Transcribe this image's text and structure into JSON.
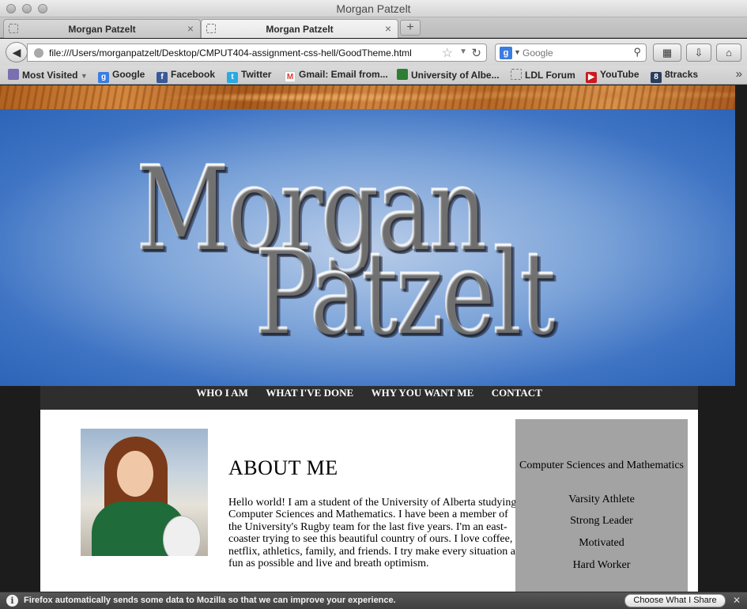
{
  "window": {
    "title": "Morgan Patzelt"
  },
  "tabs": [
    {
      "label": "Morgan Patzelt",
      "active": false
    },
    {
      "label": "Morgan Patzelt",
      "active": true
    }
  ],
  "navbar": {
    "url": "file:///Users/morganpatzelt/Desktop/CMPUT404-assignment-css-hell/GoodTheme.html",
    "search_placeholder": "Google",
    "search_engine_glyph": "g"
  },
  "bookmarks": [
    {
      "label": "Most Visited",
      "icon": "most-visited-icon",
      "color": "#7a6fb0"
    },
    {
      "label": "Google",
      "icon": "google-icon",
      "color": "#3b7de0"
    },
    {
      "label": "Facebook",
      "icon": "facebook-icon",
      "color": "#3b5998"
    },
    {
      "label": "Twitter",
      "icon": "twitter-icon",
      "color": "#2ba9e1"
    },
    {
      "label": "Gmail: Email from...",
      "icon": "gmail-icon",
      "color": "#d23f31"
    },
    {
      "label": "University of Albe...",
      "icon": "ualberta-icon",
      "color": "#2f7d32"
    },
    {
      "label": "LDL Forum",
      "icon": "page-icon",
      "color": "#aaaaaa"
    },
    {
      "label": "YouTube",
      "icon": "youtube-icon",
      "color": "#cc181e"
    },
    {
      "label": "8tracks",
      "icon": "8tracks-icon",
      "color": "#2a3e5c"
    }
  ],
  "page": {
    "banner": {
      "first_name": "Morgan",
      "last_name": "Patzelt"
    },
    "nav": [
      "WHO I AM",
      "WHAT I'VE DONE",
      "WHY YOU WANT ME",
      "CONTACT"
    ],
    "about": {
      "title": "ABOUT ME",
      "text": "Hello world! I am a student of the University of Alberta studying Computer Sciences and Mathematics. I have been a member of the University's Rugby team for the last five years. I'm an east-coaster trying to see this beautiful country of ours. I love coffee, netflix, athletics, family, and friends. I try make every situation as fun as possible and live and breath optimism."
    },
    "traits": [
      "Computer Sciences and Mathematics",
      "Varsity Athlete",
      "Strong Leader",
      "Motivated",
      "Hard Worker"
    ]
  },
  "notification": {
    "message": "Firefox automatically sends some data to Mozilla so that we can improve your experience.",
    "button": "Choose What I Share"
  }
}
